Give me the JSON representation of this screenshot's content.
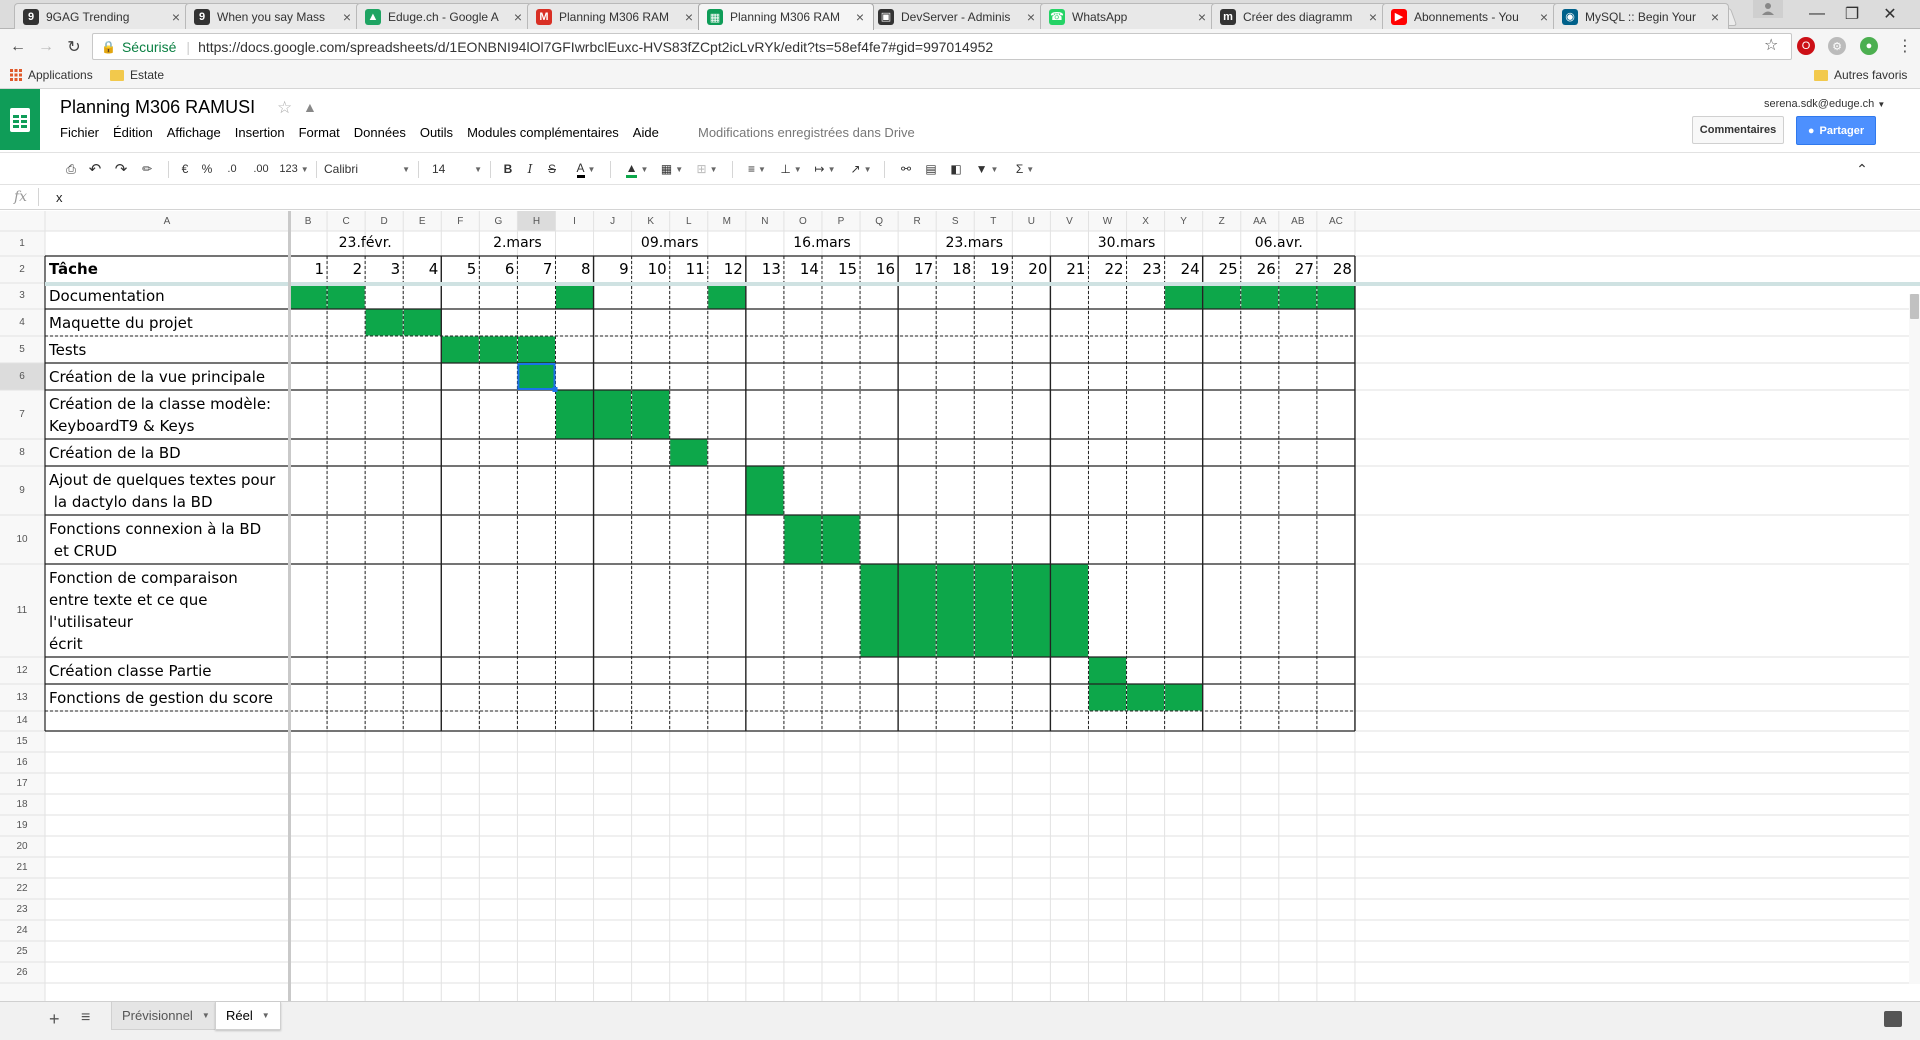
{
  "browser": {
    "tabs": [
      {
        "title": "9GAG Trending",
        "icon": "9gag-icon",
        "color": "#333333"
      },
      {
        "title": "When you say Mass",
        "icon": "9gag-icon",
        "color": "#333333"
      },
      {
        "title": "Eduge.ch - Google A",
        "icon": "google-drive-icon",
        "color": "#1fa463"
      },
      {
        "title": "Planning M306 RAM",
        "icon": "gmail-icon",
        "color": "#d93025"
      },
      {
        "title": "Planning M306 RAM",
        "icon": "sheets-icon",
        "color": "#0f9d58",
        "active": true
      },
      {
        "title": "DevServer - Adminis",
        "icon": "devserver-icon",
        "color": "#333333"
      },
      {
        "title": "WhatsApp",
        "icon": "whatsapp-icon",
        "color": "#25d366"
      },
      {
        "title": "Créer des diagramm",
        "icon": "m-logo-icon",
        "color": "#333333"
      },
      {
        "title": "Abonnements - You",
        "icon": "youtube-icon",
        "color": "#ff0000"
      },
      {
        "title": "MySQL :: Begin Your",
        "icon": "mysql-icon",
        "color": "#00618a"
      }
    ],
    "address": {
      "secure_label": "Sécurisé",
      "url": "https://docs.google.com/spreadsheets/d/1EONBNI94lOl7GFIwrbclEuxc-HVS83fZCpt2icLvRYk/edit?ts=58ef4fe7#gid=997014952"
    },
    "bookmarks": {
      "apps_label": "Applications",
      "folder_label": "Estate",
      "other_label": "Autres favoris"
    }
  },
  "sheets": {
    "title": "Planning M306 RAMUSI",
    "menu": [
      "Fichier",
      "Édition",
      "Affichage",
      "Insertion",
      "Format",
      "Données",
      "Outils",
      "Modules complémentaires",
      "Aide"
    ],
    "saved_status": "Modifications enregistrées dans Drive",
    "user": "serena.sdk@eduge.ch",
    "comments_label": "Commentaires",
    "share_label": "Partager",
    "toolbar": {
      "currency": "€",
      "percent": "%",
      "dec_less": ".0",
      "dec_more": ".00",
      "format_more": "123",
      "font": "Calibri",
      "font_size": "14",
      "bold": "B",
      "italic": "I",
      "strike": "S",
      "text_color": "A",
      "sum": "Σ"
    },
    "formula": {
      "fx": "fx",
      "value": "x"
    }
  },
  "grid": {
    "columns": [
      "A",
      "B",
      "C",
      "D",
      "E",
      "F",
      "G",
      "H",
      "I",
      "J",
      "K",
      "L",
      "M",
      "N",
      "O",
      "P",
      "Q",
      "R",
      "S",
      "T",
      "U",
      "V",
      "W",
      "X",
      "Y",
      "Z",
      "AA",
      "AB",
      "AC"
    ],
    "rows": [
      "1",
      "2",
      "3",
      "4",
      "5",
      "6",
      "7",
      "8",
      "9",
      "10",
      "11",
      "12",
      "13",
      "14",
      "15",
      "16",
      "17",
      "18",
      "19",
      "20",
      "21",
      "22",
      "23",
      "24",
      "25",
      "26"
    ],
    "week_labels": [
      {
        "col": 1,
        "text": "23.févr."
      },
      {
        "col": 5,
        "text": "2.mars"
      },
      {
        "col": 9,
        "text": "09.mars"
      },
      {
        "col": 13,
        "text": "16.mars"
      },
      {
        "col": 17,
        "text": "23.mars"
      },
      {
        "col": 21,
        "text": "30.mars"
      },
      {
        "col": 25,
        "text": "06.avr."
      }
    ],
    "task_header": "Tâche",
    "days": [
      "1",
      "2",
      "3",
      "4",
      "5",
      "6",
      "7",
      "8",
      "9",
      "10",
      "11",
      "12",
      "13",
      "14",
      "15",
      "16",
      "17",
      "18",
      "19",
      "20",
      "21",
      "22",
      "23",
      "24",
      "25",
      "26",
      "27",
      "28"
    ],
    "tasks": [
      {
        "label": [
          "Documentation"
        ],
        "days": [
          1,
          2,
          8,
          12,
          24,
          25,
          26,
          27,
          28
        ]
      },
      {
        "label": [
          "Maquette du projet"
        ],
        "days": [
          3,
          4
        ]
      },
      {
        "label": [
          "Tests"
        ],
        "days": [
          5,
          6,
          7
        ]
      },
      {
        "label": [
          "Création de la vue principale"
        ],
        "days": [
          7
        ]
      },
      {
        "label": [
          "Création de la classe modèle:",
          "KeyboardT9 & Keys"
        ],
        "days": [
          8,
          9,
          10
        ]
      },
      {
        "label": [
          "Création de la BD"
        ],
        "days": [
          11
        ]
      },
      {
        "label": [
          "Ajout de quelques textes pour",
          " la dactylo dans la BD"
        ],
        "days": [
          13
        ]
      },
      {
        "label": [
          "Fonctions connexion à la BD",
          " et CRUD"
        ],
        "days": [
          14,
          15
        ]
      },
      {
        "label": [
          "Fonction de comparaison",
          "entre texte et ce que",
          "l'utilisateur",
          "écrit"
        ],
        "days": [
          16,
          17,
          18,
          19,
          20,
          21
        ]
      },
      {
        "label": [
          "Création classe Partie"
        ],
        "days": [
          22
        ]
      },
      {
        "label": [
          "Fonctions de gestion du score"
        ],
        "days": [
          22,
          23,
          24
        ]
      }
    ],
    "selected_cell": "H6",
    "fill_color": "#0da74a"
  },
  "sheet_tabs": [
    {
      "label": "Prévisionnel",
      "active": false
    },
    {
      "label": "Réel",
      "active": true
    }
  ]
}
